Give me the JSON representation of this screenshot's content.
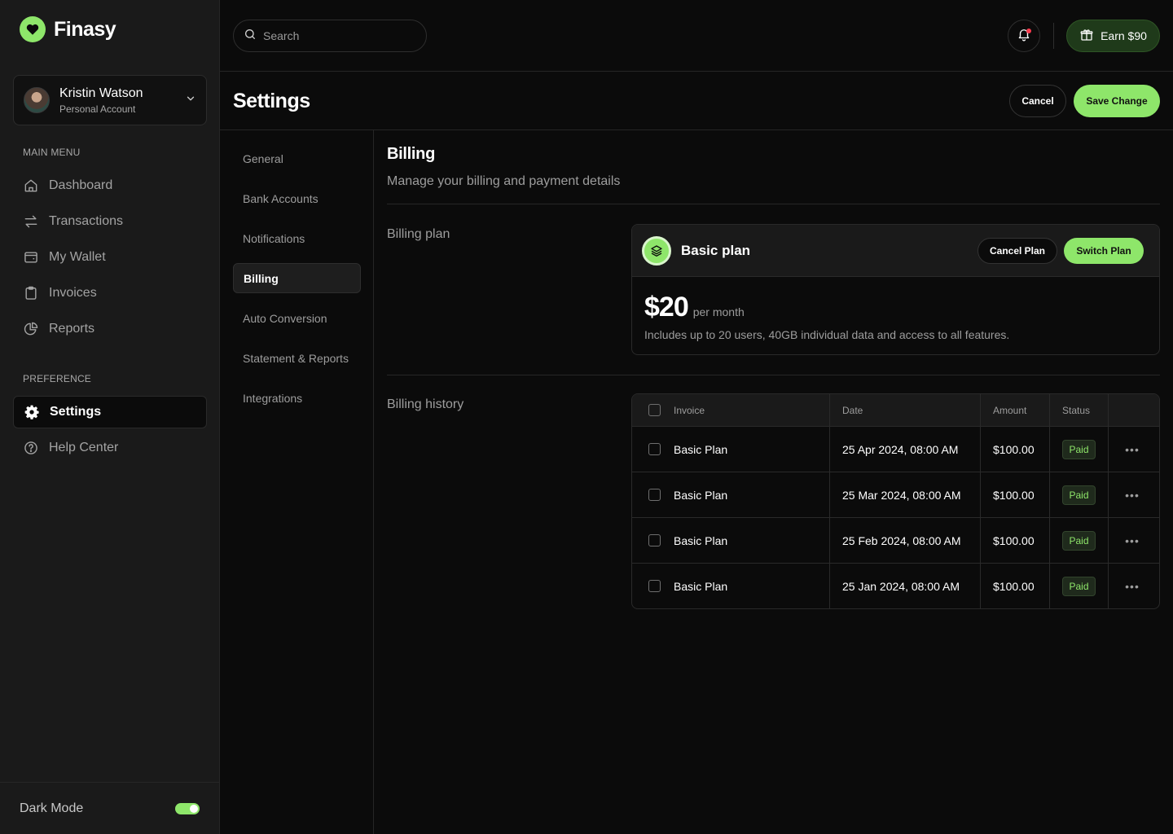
{
  "brand": {
    "name": "Finasy",
    "accent": "#8ee66a"
  },
  "account": {
    "name": "Kristin Watson",
    "type": "Personal Account"
  },
  "sidebar": {
    "main_menu_label": "MAIN MENU",
    "main_items": [
      {
        "label": "Dashboard",
        "icon": "home-icon"
      },
      {
        "label": "Transactions",
        "icon": "arrows-icon"
      },
      {
        "label": "My Wallet",
        "icon": "wallet-icon"
      },
      {
        "label": "Invoices",
        "icon": "clipboard-icon"
      },
      {
        "label": "Reports",
        "icon": "pie-chart-icon"
      }
    ],
    "preference_label": "PREFERENCE",
    "preference_items": [
      {
        "label": "Settings",
        "icon": "gear-icon",
        "active": true
      },
      {
        "label": "Help Center",
        "icon": "help-icon"
      }
    ],
    "dark_mode_label": "Dark Mode",
    "dark_mode_on": true
  },
  "topbar": {
    "search_placeholder": "Search",
    "earn_label": "Earn $90"
  },
  "page": {
    "title": "Settings",
    "cancel_label": "Cancel",
    "save_label": "Save Change"
  },
  "settings_nav": [
    {
      "label": "General"
    },
    {
      "label": "Bank Accounts"
    },
    {
      "label": "Notifications"
    },
    {
      "label": "Billing",
      "active": true
    },
    {
      "label": "Auto Conversion"
    },
    {
      "label": "Statement & Reports"
    },
    {
      "label": "Integrations"
    }
  ],
  "billing": {
    "title": "Billing",
    "subtitle": "Manage your billing and payment details",
    "plan_label": "Billing plan",
    "plan": {
      "name": "Basic plan",
      "cancel_label": "Cancel Plan",
      "switch_label": "Switch Plan",
      "price": "$20",
      "period": "per month",
      "description": "Includes up to 20 users, 40GB individual data and access to all features."
    },
    "history_label": "Billing history",
    "table": {
      "headers": {
        "invoice": "Invoice",
        "date": "Date",
        "amount": "Amount",
        "status": "Status"
      },
      "rows": [
        {
          "invoice": "Basic Plan",
          "date": "25 Apr 2024, 08:00 AM",
          "amount": "$100.00",
          "status": "Paid"
        },
        {
          "invoice": "Basic Plan",
          "date": "25 Mar 2024, 08:00 AM",
          "amount": "$100.00",
          "status": "Paid"
        },
        {
          "invoice": "Basic Plan",
          "date": "25 Feb 2024, 08:00 AM",
          "amount": "$100.00",
          "status": "Paid"
        },
        {
          "invoice": "Basic Plan",
          "date": "25 Jan 2024, 08:00 AM",
          "amount": "$100.00",
          "status": "Paid"
        }
      ]
    }
  }
}
